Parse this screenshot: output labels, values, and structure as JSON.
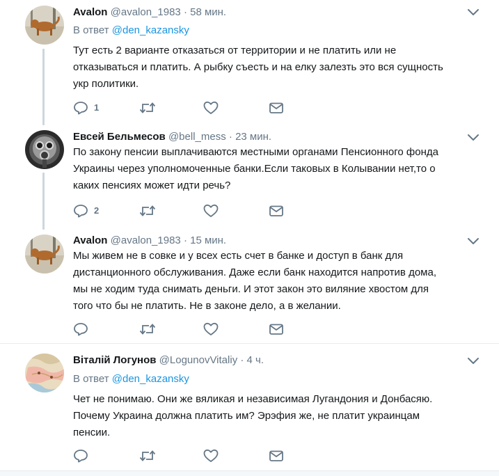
{
  "tweets": [
    {
      "name": "Avalon",
      "handle": "@avalon_1983",
      "separator": "·",
      "time": "58 мин.",
      "reply_prefix": "В ответ",
      "reply_to": "@den_kazansky",
      "text_lines": [
        "Тут есть 2 варианте отказаться от территории и не платить или не",
        "отказываться и платить. А рыбку съесть и на елку залезть это вся сущность",
        "укр политики."
      ],
      "reply_count": "1",
      "avatar": "dog-photo-avatar"
    },
    {
      "name": "Евсей Бельмесов",
      "handle": "@bell_mess",
      "separator": "·",
      "time": "23 мин.",
      "text_lines": [
        "По закону пенсии выплачиваются местными органами Пенсионного фонда",
        "Украины через уполномоченные банки.Если таковых в Колывании нет,то о",
        "каких пенсиях может идти речь?"
      ],
      "reply_count": "2",
      "avatar": "gas-mask-avatar"
    },
    {
      "name": "Avalon",
      "handle": "@avalon_1983",
      "separator": "·",
      "time": "15 мин.",
      "text_lines": [
        "Мы живем не в совке и у всех есть счет в банке и доступ в банк для",
        "дистанционного обслуживания. Даже если банк находится напротив дома,",
        "мы не ходим туда  снимать деньги. И этот закон это виляние хвостом для",
        "того что бы не платить. Не в законе дело, а в желании."
      ],
      "reply_count": "",
      "avatar": "dog-photo-avatar"
    },
    {
      "name": "Віталій Логунов",
      "handle": "@LogunovVitaliy",
      "separator": "·",
      "time": "4 ч.",
      "reply_prefix": "В ответ",
      "reply_to": "@den_kazansky",
      "text_lines": [
        "Чет не понимаю. Они же вяликая и независимая Лугандония и Донбасяю.",
        "Почему Украина должна платить им? Эрэфия же, не платит украинцам",
        "пенсии."
      ],
      "reply_count": "",
      "avatar": "map-avatar"
    }
  ],
  "icons": {
    "reply": "reply-icon",
    "retweet": "retweet-icon",
    "like": "heart-icon",
    "dm": "envelope-icon",
    "more": "chevron-down-icon"
  },
  "colors": {
    "text": "#14171a",
    "secondary": "#657786",
    "link": "#1b95e0",
    "thread_line": "#ccd6dd",
    "divider": "#e6ecf0"
  }
}
